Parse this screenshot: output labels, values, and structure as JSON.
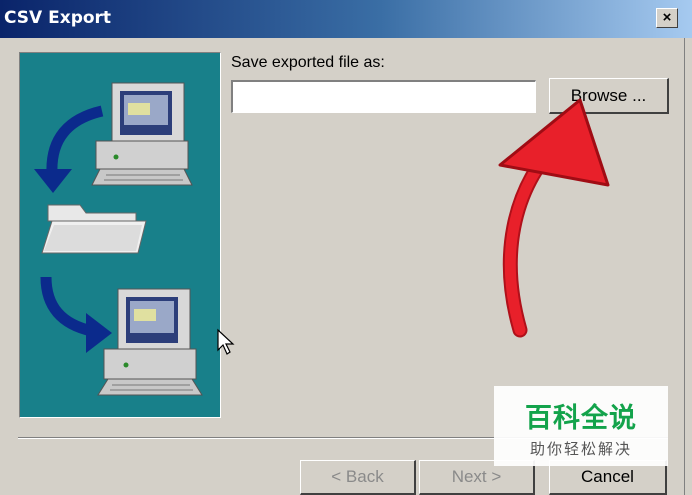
{
  "window": {
    "title": "CSV Export",
    "close_glyph": "×",
    "icon": "close-icon"
  },
  "form": {
    "save_label": "Save exported file as:",
    "path_value": "",
    "path_placeholder": "",
    "browse_label": "Browse ..."
  },
  "footer": {
    "back_label": "< Back",
    "next_label": "Next >",
    "cancel_label": "Cancel"
  },
  "illustration": {
    "icons": [
      "computer-icon",
      "folder-icon",
      "computer-icon"
    ],
    "background_color": "#18808a"
  },
  "annotation": {
    "arrow_color": "#e8202a"
  },
  "watermark": {
    "main": "百科全说",
    "sub": "助你轻松解决"
  }
}
